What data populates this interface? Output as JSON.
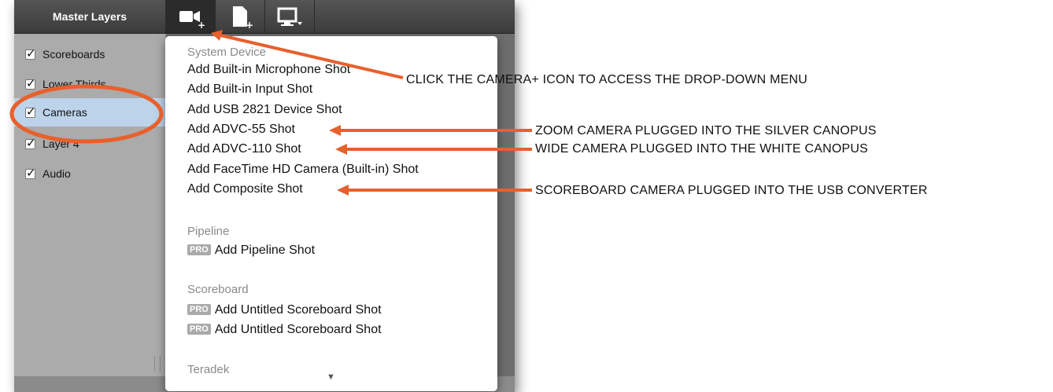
{
  "sidebar": {
    "header": "Master Layers",
    "layers": [
      {
        "label": "Scoreboards",
        "checked": true
      },
      {
        "label": "Lower Thirds",
        "checked": true
      },
      {
        "label": "Cameras",
        "checked": true,
        "selected": true
      },
      {
        "label": "Layer 4",
        "checked": true
      },
      {
        "label": "Audio",
        "checked": true
      }
    ]
  },
  "toolbar": {
    "icons": [
      "camera-plus-icon",
      "document-plus-icon",
      "monitor-dropdown-icon"
    ]
  },
  "menu": {
    "sections": [
      {
        "title": "System Device",
        "items": [
          {
            "label": "Add Built-in Microphone Shot"
          },
          {
            "label": "Add Built-in Input Shot"
          },
          {
            "label": "Add USB 2821 Device Shot"
          },
          {
            "label": "Add ADVC-55 Shot"
          },
          {
            "label": "Add ADVC-110 Shot"
          },
          {
            "label": "Add FaceTime HD Camera (Built-in) Shot"
          },
          {
            "label": "Add Composite Shot"
          }
        ]
      },
      {
        "title": "Pipeline",
        "items": [
          {
            "label": "Add Pipeline Shot",
            "badge": "PRO"
          }
        ]
      },
      {
        "title": "Scoreboard",
        "items": [
          {
            "label": "Add Untitled Scoreboard Shot",
            "badge": "PRO"
          },
          {
            "label": "Add Untitled Scoreboard Shot",
            "badge": "PRO"
          }
        ]
      },
      {
        "title": "Teradek",
        "items": []
      }
    ],
    "scroll_indicator": "▼"
  },
  "annotations": {
    "camera_icon": "CLICK THE CAMERA+ ICON TO ACCESS THE DROP-DOWN MENU",
    "advc55": "ZOOM CAMERA PLUGGED INTO THE SILVER CANOPUS",
    "advc110": "WIDE CAMERA PLUGGED INTO THE WHITE CANOPUS",
    "composite": "SCOREBOARD CAMERA PLUGGED INTO THE USB CONVERTER"
  },
  "colors": {
    "annotation": "#e8602c",
    "selected_layer": "#bcd3ea"
  }
}
